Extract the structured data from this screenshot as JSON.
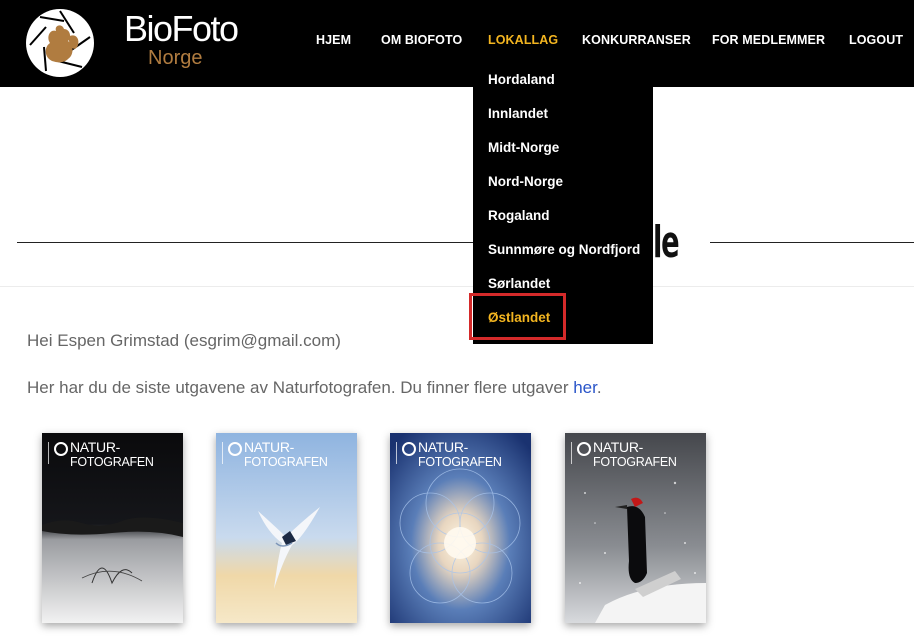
{
  "brand": {
    "name_top": "BioFoto",
    "name_bottom": "Norge",
    "logo_icon": "squirrel-aperture-icon"
  },
  "nav": {
    "items": [
      {
        "label": "HJEM",
        "active": false
      },
      {
        "label": "OM BIOFOTO",
        "active": false
      },
      {
        "label": "LOKALLAG",
        "active": true
      },
      {
        "label": "KONKURRANSER",
        "active": false
      },
      {
        "label": "FOR MEDLEMMER",
        "active": false
      },
      {
        "label": "LOGOUT",
        "active": false
      }
    ]
  },
  "dropdown": {
    "items": [
      {
        "label": "Hordaland"
      },
      {
        "label": "Innlandet"
      },
      {
        "label": "Midt-Norge"
      },
      {
        "label": "Nord-Norge"
      },
      {
        "label": "Rogaland"
      },
      {
        "label": "Sunnmøre og Nordfjord"
      },
      {
        "label": "Sørlandet"
      },
      {
        "label": "Østlandet",
        "active": true
      }
    ]
  },
  "page": {
    "title_fragment": "le"
  },
  "content": {
    "greeting": "Hei Espen Grimstad (esgrim@gmail.com)",
    "intro_text": "Her har du de siste utgavene av Naturfotografen. Du finner flere utgaver ",
    "intro_link": "her",
    "intro_end": "."
  },
  "magazines": [
    {
      "title_line1": "NATUR-",
      "title_line2": "FOTOGRAFEN"
    },
    {
      "title_line1": "NATUR-",
      "title_line2": "FOTOGRAFEN"
    },
    {
      "title_line1": "NATUR-",
      "title_line2": "FOTOGRAFEN"
    },
    {
      "title_line1": "NATUR-",
      "title_line2": "FOTOGRAFEN"
    }
  ],
  "colors": {
    "accent": "#f3b520",
    "header_bg": "#000000",
    "brand_bronze": "#b07c40",
    "link": "#2a55c9",
    "highlight": "#d42a2a"
  }
}
